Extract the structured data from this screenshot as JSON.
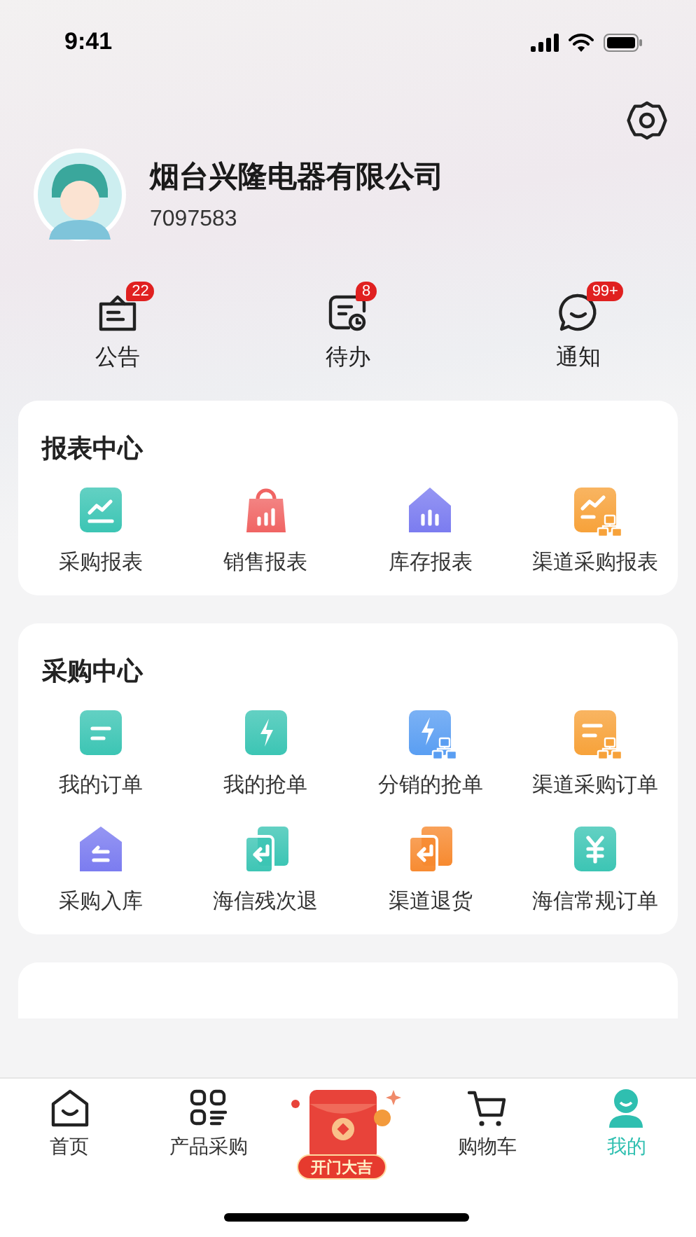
{
  "status_bar": {
    "time": "9:41"
  },
  "profile": {
    "company": "烟台兴隆电器有限公司",
    "account": "7097583"
  },
  "quick_links": [
    {
      "label": "公告",
      "badge": "22",
      "kind": "notice"
    },
    {
      "label": "待办",
      "badge": "8",
      "kind": "todo"
    },
    {
      "label": "通知",
      "badge": "99+",
      "kind": "message"
    }
  ],
  "sections": [
    {
      "title": "报表中心",
      "items": [
        {
          "label": "采购报表",
          "kind": "chart",
          "color": "#3cc5b4"
        },
        {
          "label": "销售报表",
          "kind": "bag",
          "color": "#f06463"
        },
        {
          "label": "库存报表",
          "kind": "house",
          "color": "#7b7cf0"
        },
        {
          "label": "渠道采购报表",
          "kind": "chart-org",
          "color": "#f7a23a"
        }
      ]
    },
    {
      "title": "采购中心",
      "items": [
        {
          "label": "我的订单",
          "kind": "doc",
          "color": "#3cc5b4"
        },
        {
          "label": "我的抢单",
          "kind": "bolt",
          "color": "#3cc5b4"
        },
        {
          "label": "分销的抢单",
          "kind": "bolt-org",
          "color": "#5a9ef2"
        },
        {
          "label": "渠道采购订单",
          "kind": "doc-org",
          "color": "#f7a23a"
        },
        {
          "label": "采购入库",
          "kind": "inbound",
          "color": "#7b7cf0"
        },
        {
          "label": "海信残次退",
          "kind": "return",
          "color": "#3cc5b4"
        },
        {
          "label": "渠道退货",
          "kind": "return",
          "color": "#f78a30"
        },
        {
          "label": "海信常规订单",
          "kind": "yen",
          "color": "#3cc5b4"
        }
      ]
    }
  ],
  "tab_bar": [
    {
      "kind": "home",
      "label": "首页",
      "selected": false
    },
    {
      "kind": "grid",
      "label": "产品采购",
      "selected": false
    },
    {
      "kind": "promo",
      "label": "开门大吉",
      "selected": false
    },
    {
      "kind": "cart",
      "label": "购物车",
      "selected": false
    },
    {
      "kind": "person",
      "label": "我的",
      "selected": true
    }
  ]
}
